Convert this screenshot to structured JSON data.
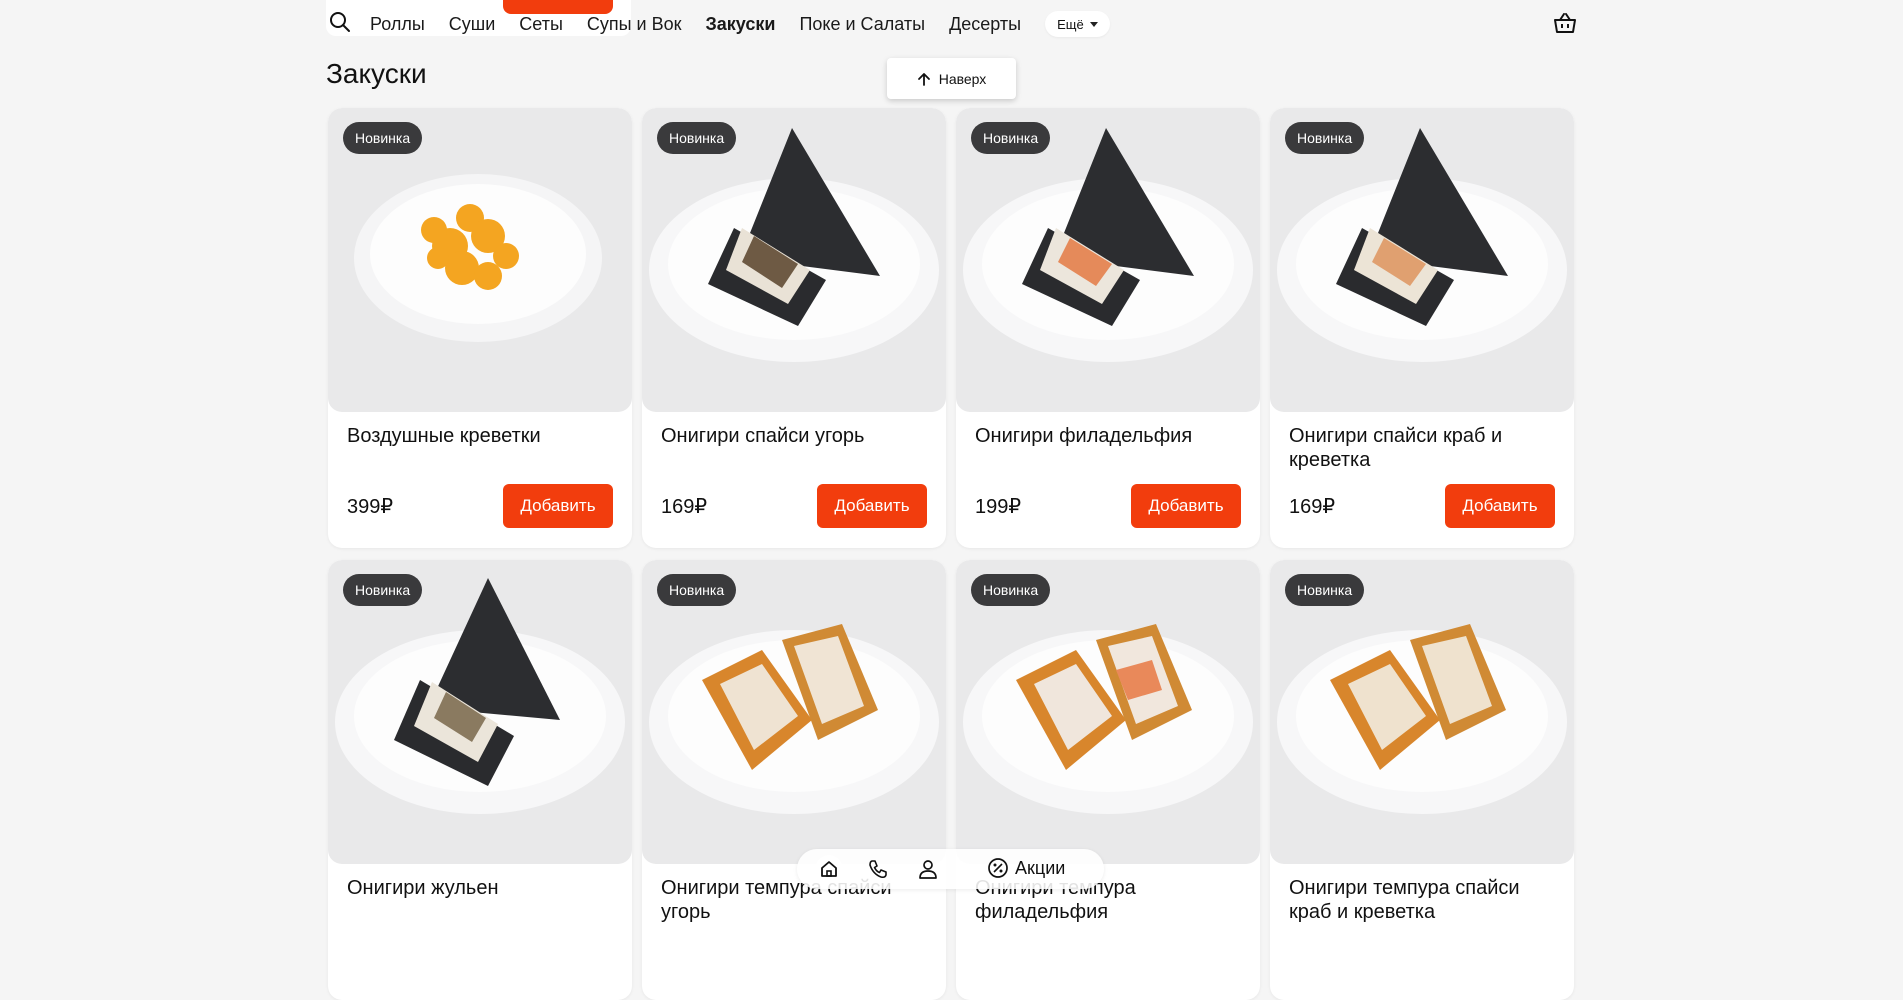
{
  "nav": {
    "items": [
      {
        "label": "Роллы",
        "active": false
      },
      {
        "label": "Суши",
        "active": false
      },
      {
        "label": "Сеты",
        "active": false
      },
      {
        "label": "Супы и Вок",
        "active": false
      },
      {
        "label": "Закуски",
        "active": true
      },
      {
        "label": "Поке и Салаты",
        "active": false
      },
      {
        "label": "Десерты",
        "active": false
      }
    ],
    "more_label": "Ещё"
  },
  "section_title": "Закуски",
  "scroll_top_label": "Наверх",
  "badge_label": "Новинка",
  "add_label": "Добавить",
  "products": [
    {
      "name": "Воздушные креветки",
      "price": "399₽",
      "image": "fried-shrimp"
    },
    {
      "name": "Онигири спайси угорь",
      "price": "169₽",
      "image": "onigiri"
    },
    {
      "name": "Онигири филадельфия",
      "price": "199₽",
      "image": "onigiri"
    },
    {
      "name": "Онигири спайси краб и креветка",
      "price": "169₽",
      "image": "onigiri"
    },
    {
      "name": "Онигири жульен",
      "price": "",
      "image": "onigiri"
    },
    {
      "name": "Онигири темпура спайси угорь",
      "price": "",
      "image": "tempura-onigiri"
    },
    {
      "name": "Онигири темпура филадельфия",
      "price": "",
      "image": "tempura-onigiri"
    },
    {
      "name": "Онигири темпура спайси краб и креветка",
      "price": "",
      "image": "tempura-onigiri"
    }
  ],
  "bottom_bar": {
    "promo_label": "Акции"
  },
  "colors": {
    "accent": "#f23d0d",
    "badge": "#3a3a3c",
    "background": "#f5f5f5"
  }
}
